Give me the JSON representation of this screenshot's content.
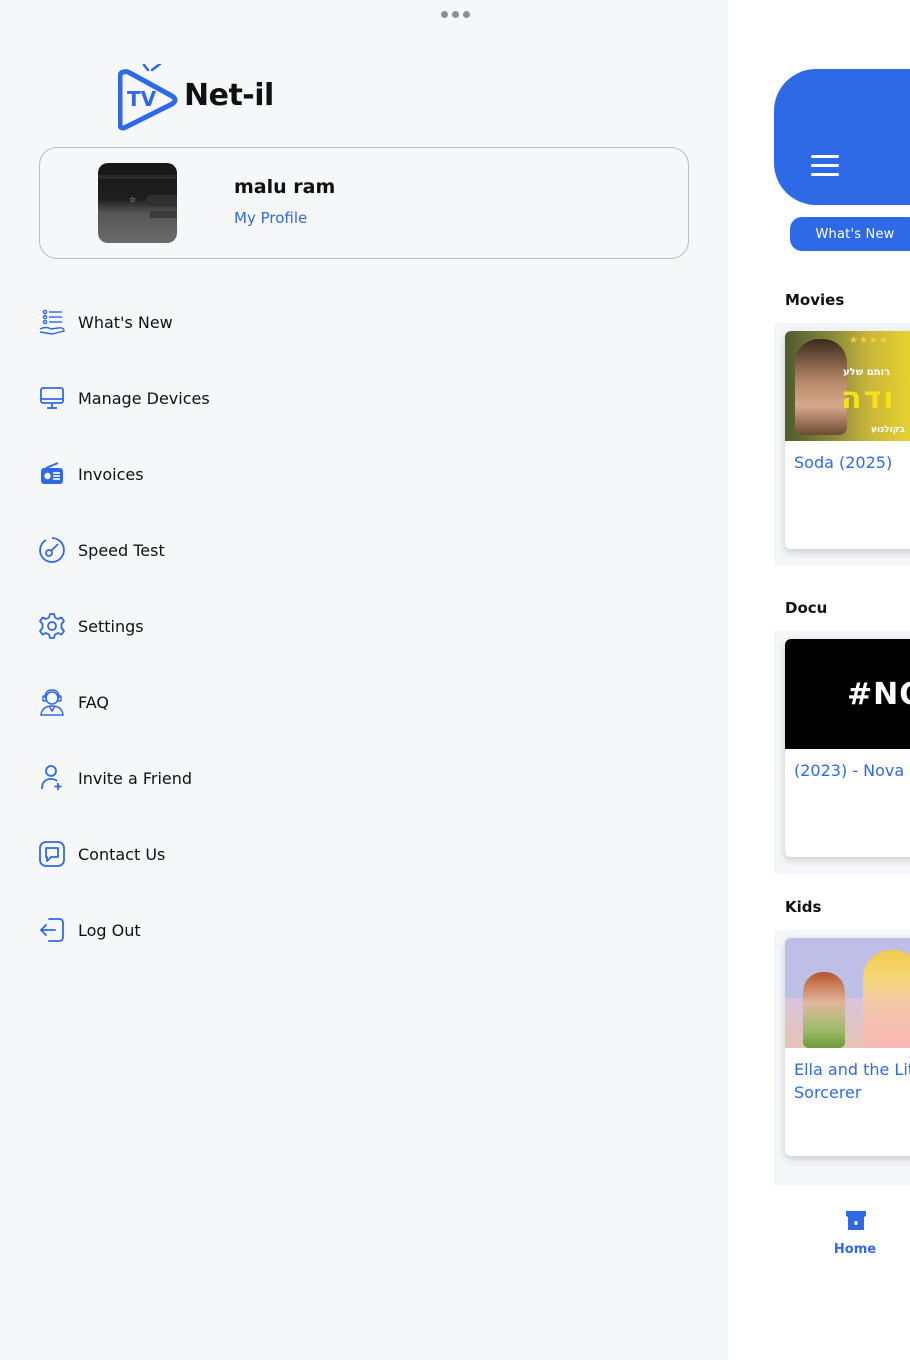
{
  "drawer": {
    "logo_text": "Net-il",
    "logo_badge": "TV",
    "profile": {
      "name": "malu ram",
      "link_label": "My Profile"
    },
    "menu": [
      {
        "label": "What's New",
        "icon": "whats-new-icon"
      },
      {
        "label": "Manage Devices",
        "icon": "monitor-icon"
      },
      {
        "label": "Invoices",
        "icon": "radio-icon"
      },
      {
        "label": "Speed Test",
        "icon": "speedometer-icon"
      },
      {
        "label": "Settings",
        "icon": "gear-icon"
      },
      {
        "label": "FAQ",
        "icon": "support-agent-icon"
      },
      {
        "label": "Invite a Friend",
        "icon": "add-user-icon"
      },
      {
        "label": "Contact Us",
        "icon": "chat-icon"
      },
      {
        "label": "Log Out",
        "icon": "logout-icon"
      }
    ]
  },
  "background_app": {
    "whats_new_button": "What's New",
    "sections": [
      {
        "title": "Movies",
        "card_title": "Soda (2025)"
      },
      {
        "title": "Docu",
        "card_title": "(2023) - Nova"
      },
      {
        "title": "Kids",
        "card_title_line1": "Ella and the Lit",
        "card_title_line2": "Sorcerer"
      }
    ],
    "poster_text": {
      "soda_stars": "★★★★",
      "soda_heb": "רותם שלע",
      "soda_big": "ודה",
      "soda_low": "בקולנוע",
      "nova": "#NO"
    },
    "bottom_nav": {
      "home_label": "Home"
    }
  },
  "colors": {
    "accent": "#2f6ae6",
    "drawer_bg": "#f6f7f9",
    "text": "#111111"
  }
}
